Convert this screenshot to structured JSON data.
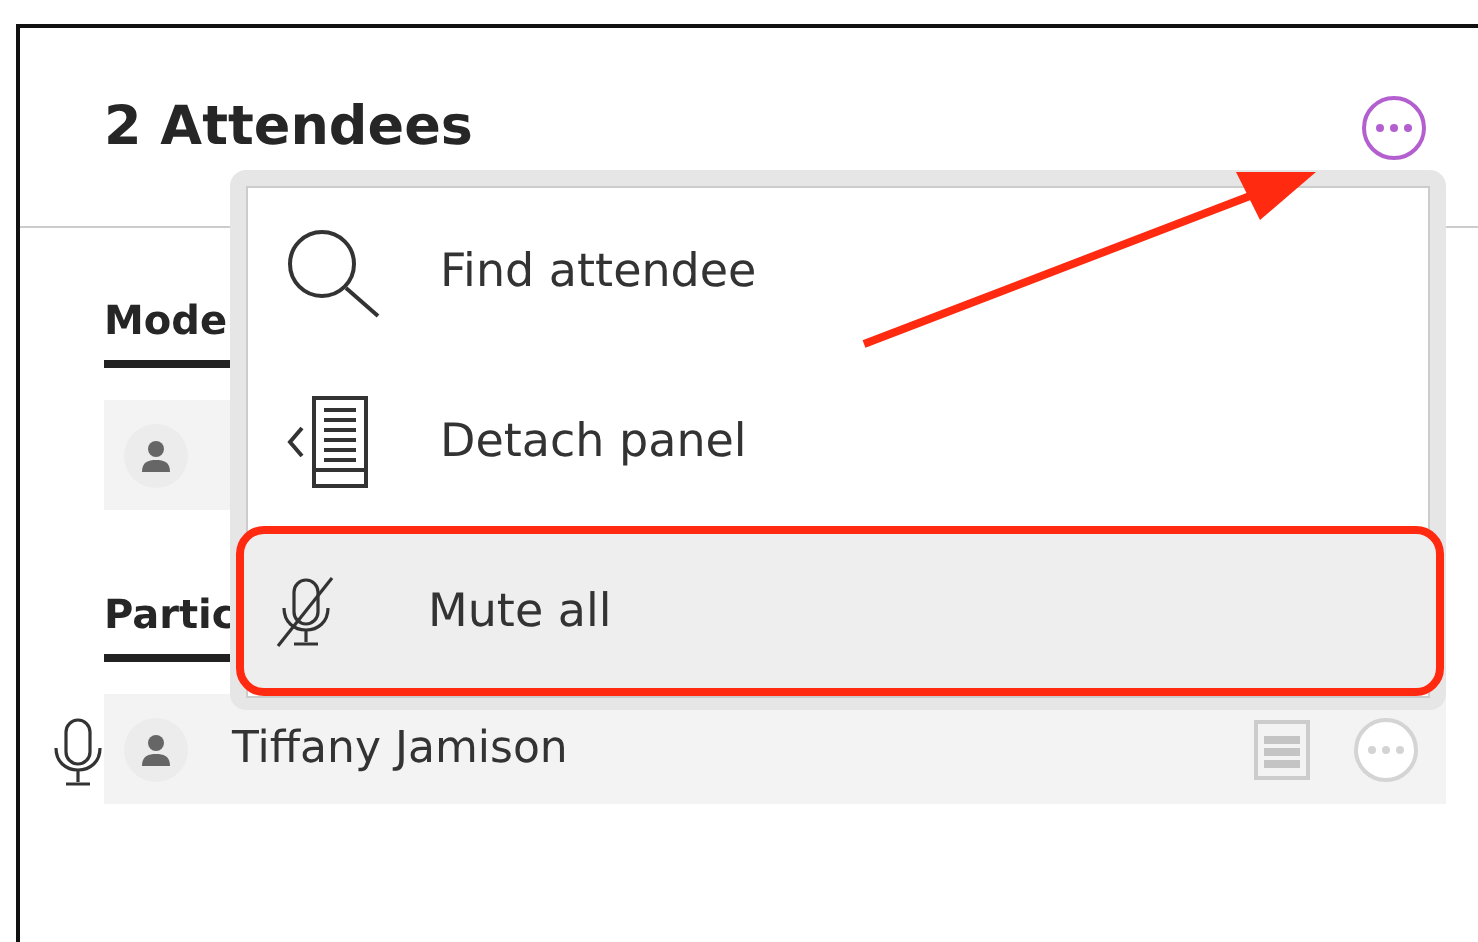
{
  "header": {
    "title": "2 Attendees"
  },
  "sections": [
    {
      "heading": "Mode",
      "attendees": [
        {
          "avatar": true
        }
      ]
    },
    {
      "heading": "Partic",
      "attendees": [
        {
          "avatar": true,
          "name": "Tiffany Jamison",
          "mic": true
        }
      ]
    }
  ],
  "menu": {
    "items": [
      {
        "kind": "search",
        "label": "Find attendee",
        "highlighted": false
      },
      {
        "kind": "detach",
        "label": "Detach panel",
        "highlighted": false
      },
      {
        "kind": "mute",
        "label": "Mute all",
        "highlighted": true
      }
    ]
  },
  "annotation": {
    "arrow": true
  }
}
